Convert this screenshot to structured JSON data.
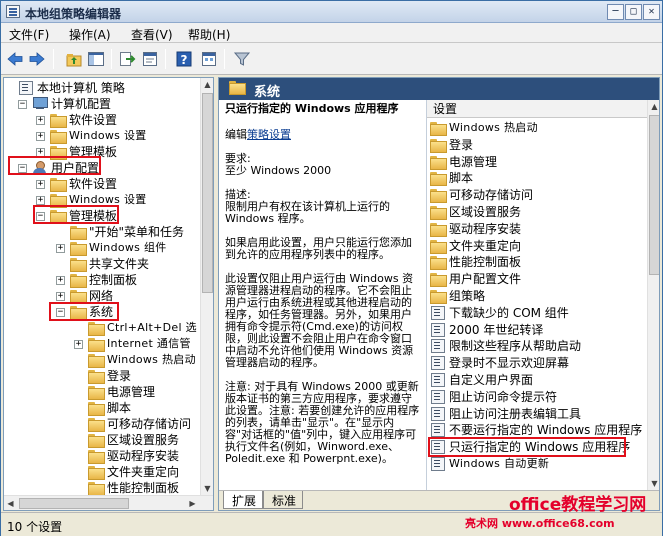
{
  "window": {
    "title": "本地组策略编辑器",
    "controls": {
      "minimize": "─",
      "maximize": "□",
      "close": "✕"
    }
  },
  "menu": [
    "文件(F)",
    "操作(A)",
    "查看(V)",
    "帮助(H)"
  ],
  "toolbar": {
    "icons": [
      "back-arrow-icon",
      "forward-arrow-icon",
      "up-folder-icon",
      "show-hide-tree-icon",
      "export-list-icon",
      "properties-icon",
      "help-icon",
      "view-icon",
      "filter-icon"
    ]
  },
  "tree": {
    "items": [
      {
        "label": "本地计算机 策略",
        "icon": "policy-icon",
        "expander": ""
      },
      {
        "label": "计算机配置",
        "icon": "computer-icon",
        "expander": "−"
      },
      {
        "label": "软件设置",
        "icon": "folder-icon",
        "expander": "+"
      },
      {
        "label": "Windows 设置",
        "icon": "folder-icon",
        "expander": "+"
      },
      {
        "label": "管理模板",
        "icon": "folder-icon",
        "expander": "+"
      },
      {
        "label": "用户配置",
        "icon": "user-icon",
        "expander": "−"
      },
      {
        "label": "软件设置",
        "icon": "folder-icon",
        "expander": "+"
      },
      {
        "label": "Windows 设置",
        "icon": "folder-icon",
        "expander": "+"
      },
      {
        "label": "管理模板",
        "icon": "folder-icon",
        "expander": "−"
      },
      {
        "label": "\"开始\"菜单和任务",
        "icon": "folder-icon",
        "expander": ""
      },
      {
        "label": "Windows 组件",
        "icon": "folder-icon",
        "expander": "+"
      },
      {
        "label": "共享文件夹",
        "icon": "folder-icon",
        "expander": ""
      },
      {
        "label": "控制面板",
        "icon": "folder-icon",
        "expander": "+"
      },
      {
        "label": "网络",
        "icon": "folder-icon",
        "expander": "+"
      },
      {
        "label": "系统",
        "icon": "folder-icon",
        "expander": "−"
      },
      {
        "label": "Ctrl+Alt+Del 选",
        "icon": "folder-icon",
        "expander": ""
      },
      {
        "label": "Internet 通信管",
        "icon": "folder-icon",
        "expander": "+"
      },
      {
        "label": "Windows 热启动",
        "icon": "folder-icon",
        "expander": ""
      },
      {
        "label": "登录",
        "icon": "folder-icon",
        "expander": ""
      },
      {
        "label": "电源管理",
        "icon": "folder-icon",
        "expander": ""
      },
      {
        "label": "脚本",
        "icon": "folder-icon",
        "expander": ""
      },
      {
        "label": "可移动存储访问",
        "icon": "folder-icon",
        "expander": ""
      },
      {
        "label": "区域设置服务",
        "icon": "folder-icon",
        "expander": ""
      },
      {
        "label": "驱动程序安装",
        "icon": "folder-icon",
        "expander": ""
      },
      {
        "label": "文件夹重定向",
        "icon": "folder-icon",
        "expander": ""
      },
      {
        "label": "性能控制面板",
        "icon": "folder-icon",
        "expander": ""
      }
    ]
  },
  "right": {
    "header": "系统",
    "description": {
      "policy_name": "只运行指定的 Windows 应用程序",
      "edit_link": "策略设置",
      "edit_prefix": "编辑",
      "requirement_label": "要求:",
      "requirement": "至少 Windows 2000",
      "desc_label": "描述:",
      "paragraphs": [
        "限制用户有权在该计算机上运行的 Windows 程序。",
        "如果启用此设置，用户只能运行您添加到允许的应用程序列表中的程序。",
        "此设置仅阻止用户运行由 Windows 资源管理器进程启动的程序。它不会阻止用户运行由系统进程或其他进程启动的程序，如任务管理器。另外，如果用户拥有命令提示符(Cmd.exe)的访问权限，则此设置不会阻止用户在命令窗口中启动不允许他们使用 Windows 资源管理器启动的程序。",
        "注意: 对于具有 Windows 2000 或更新版本证书的第三方应用程序，要求遵守此设置。注意: 若要创建允许的应用程序的列表，请单击\"显示\"。在\"显示内容\"对话框的\"值\"列中，键入应用程序可执行文件名(例如，Winword.exe、Poledit.exe 和 Powerpnt.exe)。"
      ]
    },
    "list": {
      "column_header": "设置",
      "items": [
        {
          "label": "Windows 热启动",
          "icon": "folder-icon"
        },
        {
          "label": "登录",
          "icon": "folder-icon"
        },
        {
          "label": "电源管理",
          "icon": "folder-icon"
        },
        {
          "label": "脚本",
          "icon": "folder-icon"
        },
        {
          "label": "可移动存储访问",
          "icon": "folder-icon"
        },
        {
          "label": "区域设置服务",
          "icon": "folder-icon"
        },
        {
          "label": "驱动程序安装",
          "icon": "folder-icon"
        },
        {
          "label": "文件夹重定向",
          "icon": "folder-icon"
        },
        {
          "label": "性能控制面板",
          "icon": "folder-icon"
        },
        {
          "label": "用户配置文件",
          "icon": "folder-icon"
        },
        {
          "label": "组策略",
          "icon": "folder-icon"
        },
        {
          "label": "下载缺少的 COM 组件",
          "icon": "policy-icon"
        },
        {
          "label": "2000 年世纪转译",
          "icon": "policy-icon"
        },
        {
          "label": "限制这些程序从帮助启动",
          "icon": "policy-icon"
        },
        {
          "label": "登录时不显示欢迎屏幕",
          "icon": "policy-icon"
        },
        {
          "label": "自定义用户界面",
          "icon": "policy-icon"
        },
        {
          "label": "阻止访问命令提示符",
          "icon": "policy-icon"
        },
        {
          "label": "阻止访问注册表编辑工具",
          "icon": "policy-icon"
        },
        {
          "label": "不要运行指定的 Windows 应用程序",
          "icon": "policy-icon"
        },
        {
          "label": "只运行指定的 Windows 应用程序",
          "icon": "policy-icon"
        },
        {
          "label": "Windows 自动更新",
          "icon": "policy-icon"
        }
      ]
    },
    "tabs": [
      "扩展",
      "标准"
    ]
  },
  "status": {
    "count": "10 个设置"
  },
  "watermark": {
    "line1": "office教程学习网",
    "line2": "亮术网 www.office68.com"
  },
  "colors": {
    "highlight": "#e0101a",
    "header_bg": "#2d4f7c",
    "watermark": "#e4002b"
  }
}
